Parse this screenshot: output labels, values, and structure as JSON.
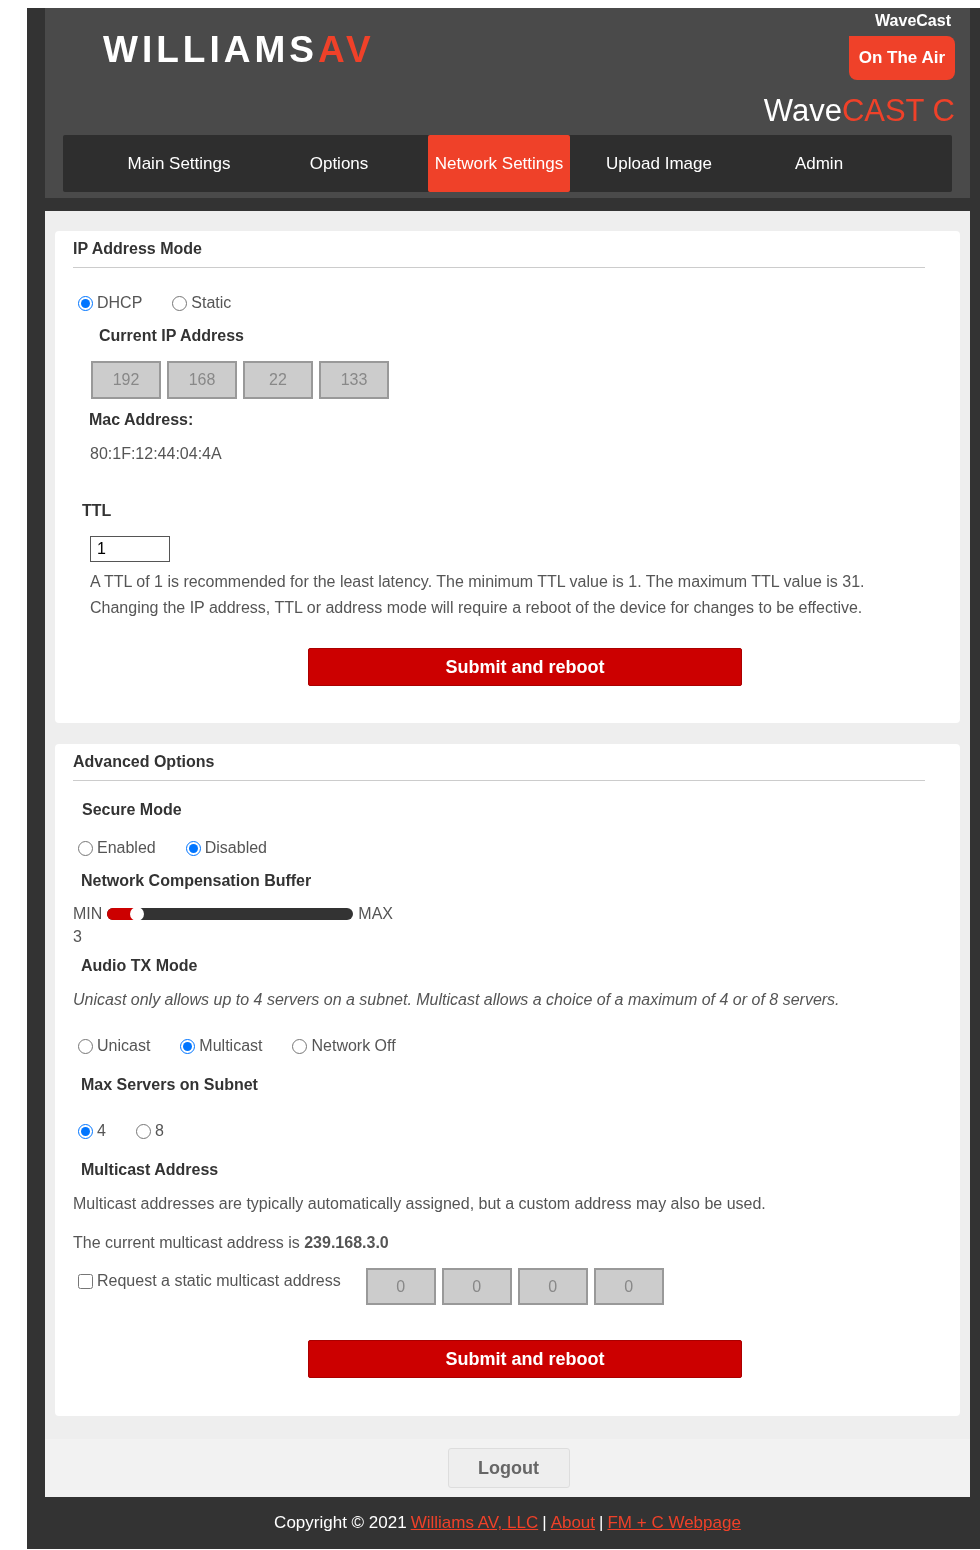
{
  "header": {
    "logo": {
      "main": "WILLIAMS",
      "accent": "AV"
    },
    "product_label": "WaveCast",
    "status_badge": "On The Air",
    "product_name": {
      "main": "Wave",
      "accent": "CAST C"
    }
  },
  "tabs": [
    {
      "label": "Main Settings",
      "selected": false
    },
    {
      "label": "Options",
      "selected": false
    },
    {
      "label": "Network Settings",
      "selected": true
    },
    {
      "label": "Upload Image",
      "selected": false
    },
    {
      "label": "Admin",
      "selected": false
    }
  ],
  "ip_section": {
    "title": "IP Address Mode",
    "modes": [
      {
        "label": "DHCP",
        "selected": true
      },
      {
        "label": "Static",
        "selected": false
      }
    ],
    "current_ip_label": "Current IP Address",
    "current_ip": [
      "192",
      "168",
      "22",
      "133"
    ],
    "mac_label": "Mac Address:",
    "mac": "80:1F:12:44:04:4A",
    "ttl_label": "TTL",
    "ttl_value": "1",
    "notes": [
      "A TTL of 1 is recommended for the least latency. The minimum TTL value is 1. The maximum TTL value is 31.",
      "Changing the IP address, TTL or address mode will require a reboot of the device for changes to be effective."
    ],
    "submit": "Submit and reboot"
  },
  "advanced": {
    "title": "Advanced Options",
    "secure_mode": {
      "label": "Secure Mode",
      "options": [
        {
          "label": "Enabled",
          "selected": false
        },
        {
          "label": "Disabled",
          "selected": true
        }
      ]
    },
    "buffer": {
      "label": "Network Compensation Buffer",
      "min": "MIN",
      "max": "MAX",
      "level": 0.12,
      "value": "3"
    },
    "audio_tx": {
      "label": "Audio TX Mode",
      "note": "Unicast only allows up to 4 servers on a subnet. Multicast allows a choice of a maximum of 4 or of 8 servers.",
      "options": [
        {
          "label": "Unicast",
          "selected": false
        },
        {
          "label": "Multicast",
          "selected": true
        },
        {
          "label": "Network Off",
          "selected": false
        }
      ]
    },
    "max_servers": {
      "label": "Max Servers on Subnet",
      "options": [
        {
          "label": "4",
          "selected": true
        },
        {
          "label": "8",
          "selected": false
        }
      ]
    },
    "multicast": {
      "label": "Multicast Address",
      "note": "Multicast addresses are typically automatically assigned, but a custom address may also be used.",
      "current": "The current multicast address is **239.168.3.0**",
      "request": {
        "label": "Request a static multicast address",
        "checked": false
      },
      "address": [
        "0",
        "0",
        "0",
        "0"
      ]
    },
    "submit": "Submit and reboot"
  },
  "logout": "Logout",
  "footer": [
    {
      "kind": "text",
      "text": "Copyright © 2021"
    },
    {
      "kind": "link",
      "text": "Williams AV, LLC"
    },
    {
      "kind": "text",
      "text": "|"
    },
    {
      "kind": "link",
      "text": "About"
    },
    {
      "kind": "text",
      "text": "|"
    },
    {
      "kind": "link",
      "text": "FM + C Webpage"
    }
  ]
}
